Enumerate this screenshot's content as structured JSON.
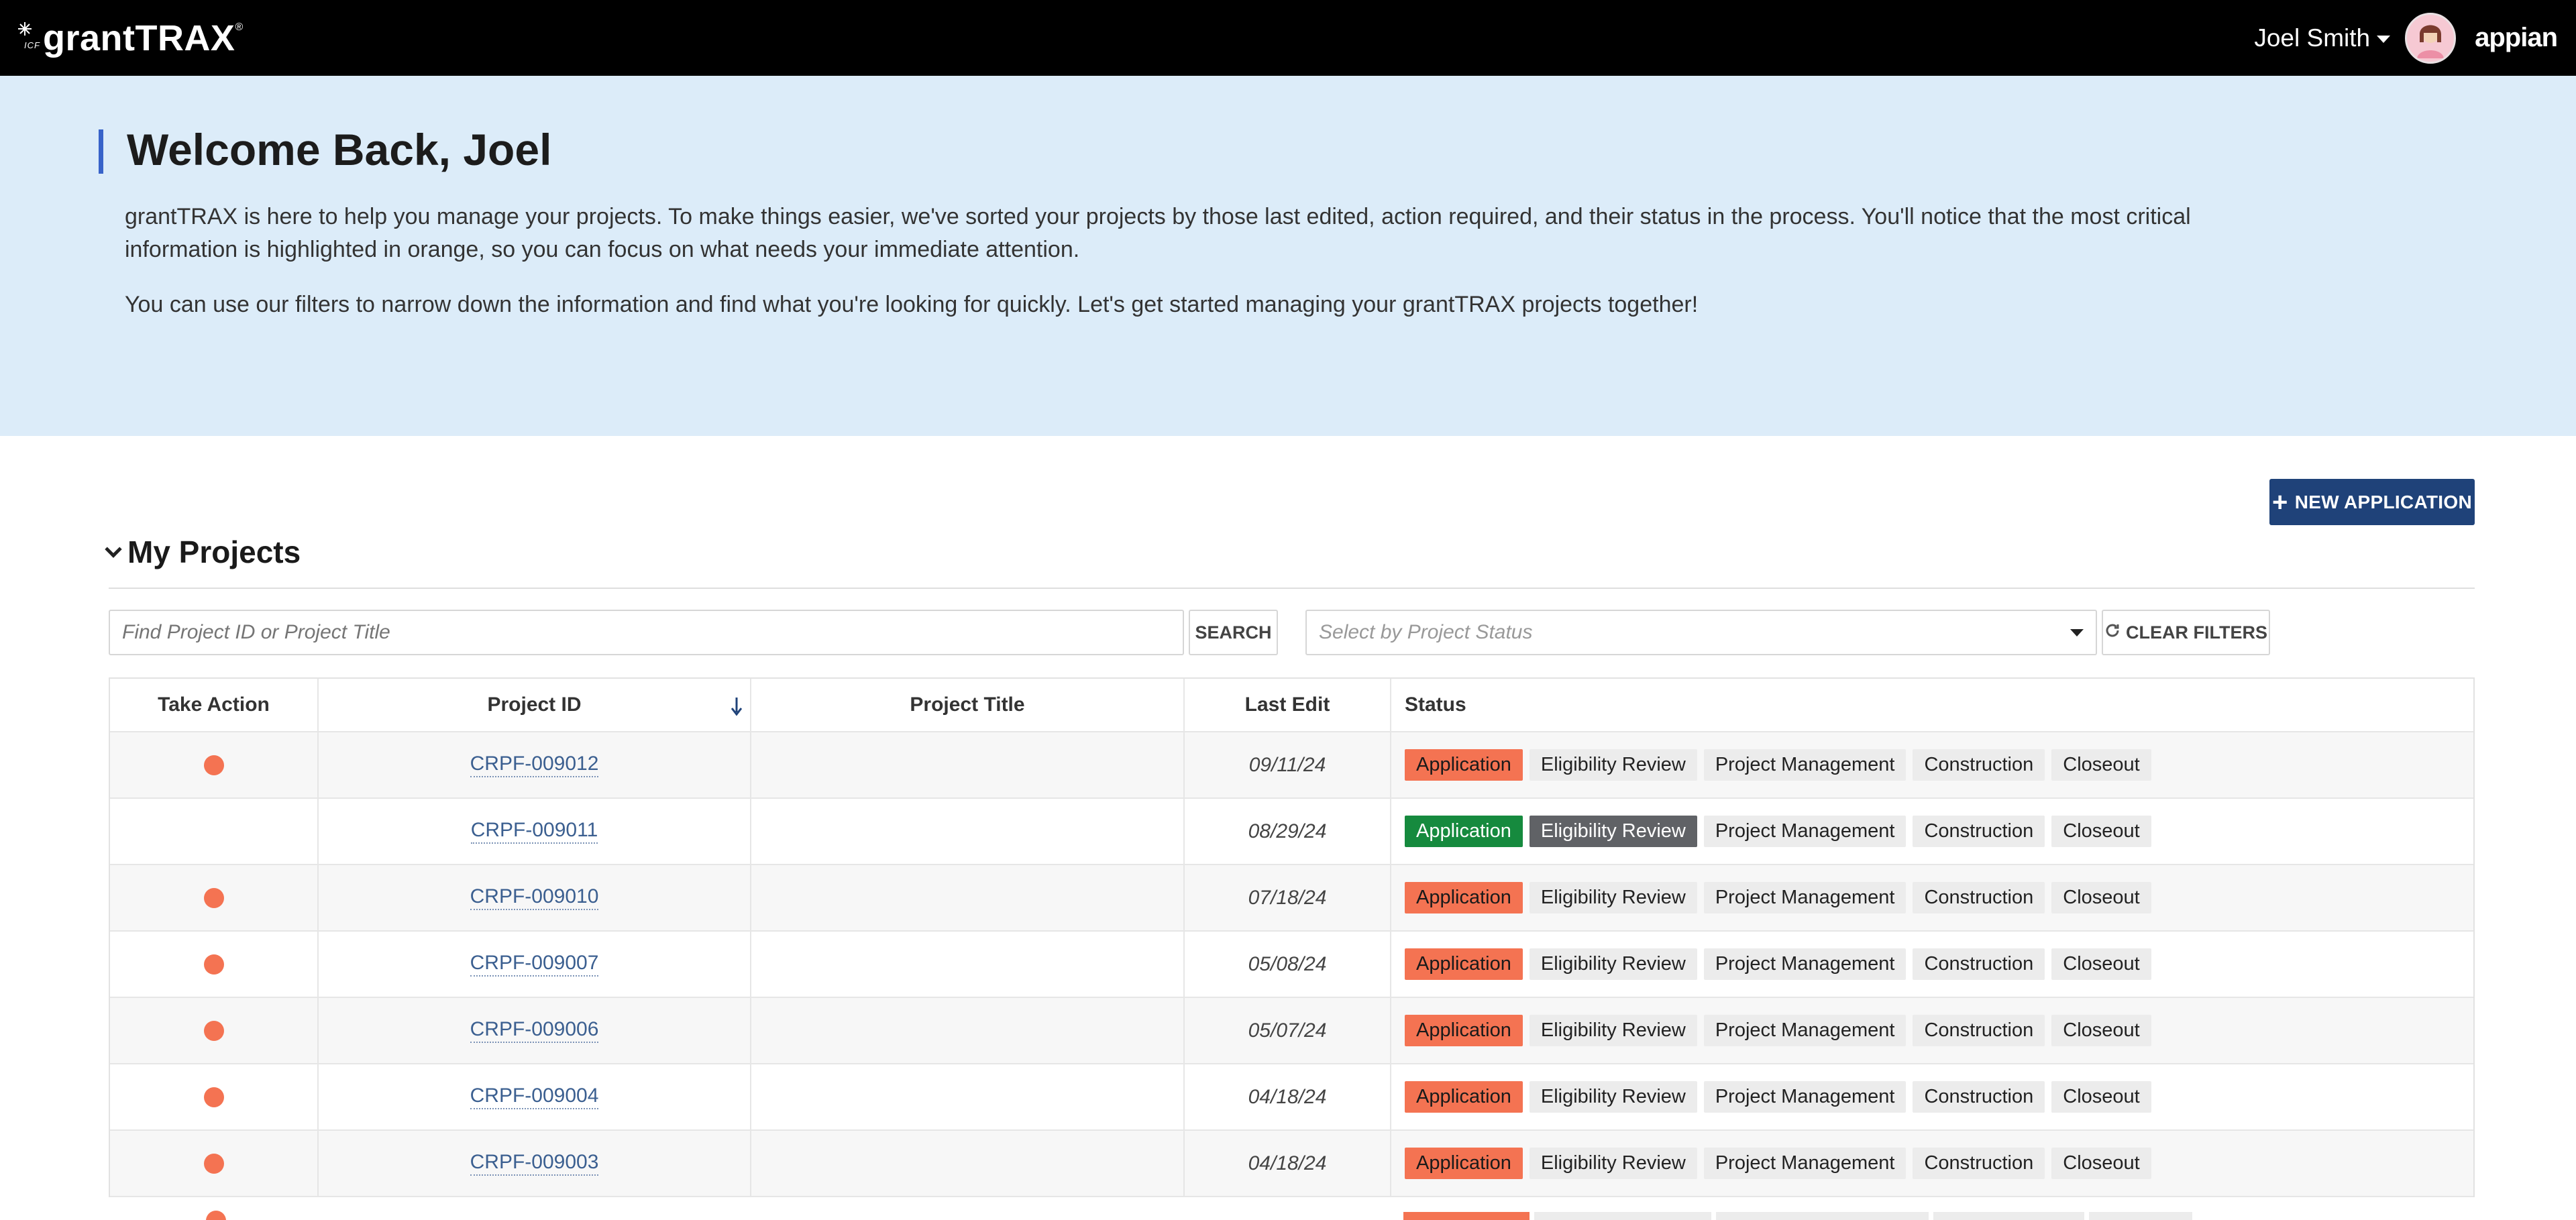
{
  "header": {
    "brand_mark": "ICF",
    "brand": "grantTRAX",
    "brand_reg": "®",
    "user_name": "Joel Smith",
    "platform": "appian"
  },
  "banner": {
    "title": "Welcome Back, Joel",
    "paragraph1": "grantTRAX is here to help you manage your projects. To make things easier, we've sorted your projects by those last edited, action required, and their status in the process. You'll notice that the most critical information is highlighted in orange, so you can focus on what needs your immediate attention.",
    "paragraph2": "You can use our filters to narrow down the information and find what you're looking for quickly. Let's get started managing your grantTRAX projects together!"
  },
  "actions": {
    "new_application": "NEW APPLICATION"
  },
  "projects": {
    "title": "My Projects",
    "search_placeholder": "Find Project ID or Project Title",
    "search_label": "SEARCH",
    "status_placeholder": "Select by Project Status",
    "clear_label": "CLEAR FILTERS",
    "columns": [
      "Take Action",
      "Project ID",
      "Project Title",
      "Last Edit",
      "Status"
    ],
    "stages": [
      "Application",
      "Eligibility Review",
      "Project Management",
      "Construction",
      "Closeout"
    ],
    "rows": [
      {
        "action": true,
        "id": "CRPF-009012",
        "title": "",
        "last_edit": "09/11/24",
        "stage_styles": [
          "orange",
          "",
          "",
          "",
          ""
        ]
      },
      {
        "action": false,
        "id": "CRPF-009011",
        "title": "",
        "last_edit": "08/29/24",
        "stage_styles": [
          "green",
          "grey",
          "",
          "",
          ""
        ]
      },
      {
        "action": true,
        "id": "CRPF-009010",
        "title": "",
        "last_edit": "07/18/24",
        "stage_styles": [
          "orange",
          "",
          "",
          "",
          ""
        ]
      },
      {
        "action": true,
        "id": "CRPF-009007",
        "title": "",
        "last_edit": "05/08/24",
        "stage_styles": [
          "orange",
          "",
          "",
          "",
          ""
        ]
      },
      {
        "action": true,
        "id": "CRPF-009006",
        "title": "",
        "last_edit": "05/07/24",
        "stage_styles": [
          "orange",
          "",
          "",
          "",
          ""
        ]
      },
      {
        "action": true,
        "id": "CRPF-009004",
        "title": "",
        "last_edit": "04/18/24",
        "stage_styles": [
          "orange",
          "",
          "",
          "",
          ""
        ]
      },
      {
        "action": true,
        "id": "CRPF-009003",
        "title": "",
        "last_edit": "04/18/24",
        "stage_styles": [
          "orange",
          "",
          "",
          "",
          ""
        ]
      }
    ]
  },
  "colors": {
    "topbar": "#000000",
    "banner": "#dcecf9",
    "primary_button": "#1f4279",
    "action_dot": "#f47352",
    "stage_current": "#f47352",
    "stage_complete": "#168a3e",
    "stage_review": "#606266"
  },
  "icons": [
    "sparkle-logo-icon",
    "caret-down-icon",
    "avatar-icon",
    "plus-icon",
    "collapse-chevron-icon",
    "sort-down-arrow-icon",
    "refresh-icon",
    "action-required-dot"
  ]
}
